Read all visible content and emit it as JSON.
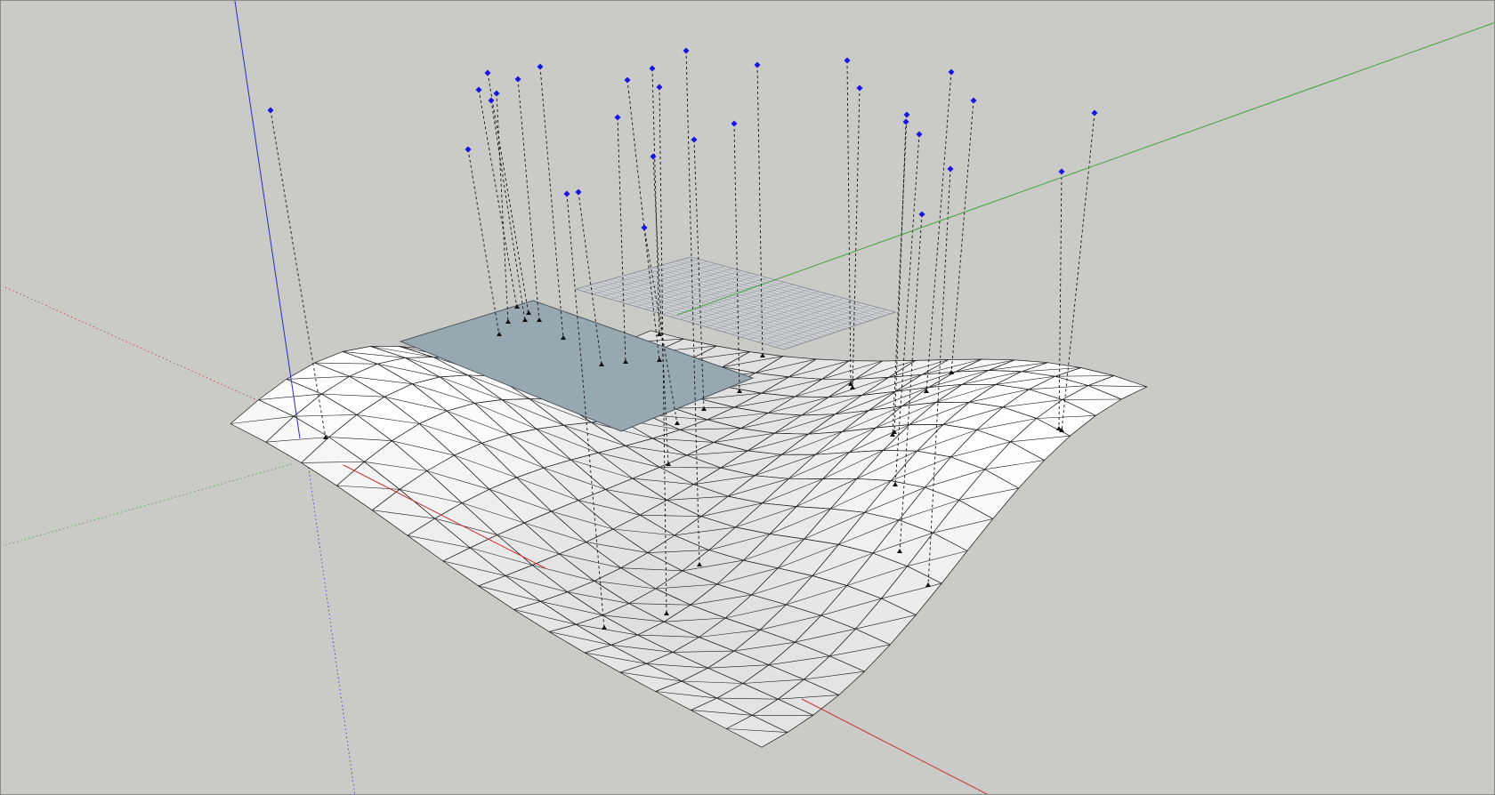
{
  "app": {
    "type": "3d-modeling-viewport"
  },
  "colors": {
    "background": "#cacac6",
    "axis_red": "#c83232",
    "axis_green": "#3fa33f",
    "axis_blue": "#2b2bd0",
    "mesh_fill": "#ffffff",
    "mesh_edge": "#1a1a1a",
    "plane_fill": "#98a8b0",
    "control_point": "#1515e8"
  },
  "scene": {
    "mesh_resolution": 15,
    "control_point_count": 31,
    "elements": [
      "axes",
      "grid-surface",
      "control-plane",
      "projection-grid",
      "control-points",
      "guide-lines"
    ]
  }
}
